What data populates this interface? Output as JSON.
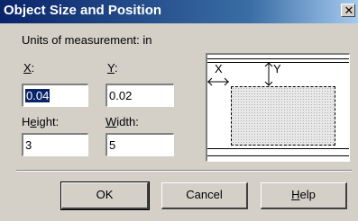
{
  "window": {
    "title": "Object Size and Position",
    "close_glyph": "✕"
  },
  "form": {
    "units_label": "Units of measurement: in",
    "x": {
      "label_key": "X",
      "label_rest": ":",
      "value": "0.04"
    },
    "y": {
      "label_key": "Y",
      "label_rest": ":",
      "value": "0.02"
    },
    "height": {
      "label_pre": "H",
      "label_key": "e",
      "label_rest": "ight:",
      "value": "3"
    },
    "width": {
      "label_key": "W",
      "label_rest": "idth:",
      "value": "5"
    }
  },
  "diagram": {
    "x_label": "X",
    "y_label": "Y"
  },
  "buttons": {
    "ok": "OK",
    "cancel": "Cancel",
    "help_key": "H",
    "help_rest": "elp"
  }
}
